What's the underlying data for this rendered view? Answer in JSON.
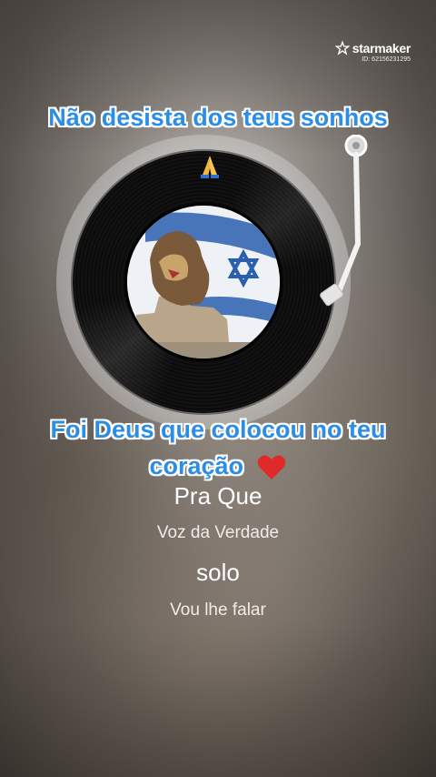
{
  "watermark": {
    "brand": "starmaker",
    "id": "ID: 62156231295"
  },
  "lyrics": {
    "line1": "Não desista dos teus sonhos",
    "line2a": "Foi Deus que colocou no teu",
    "line2b": "coração",
    "next": "Vou lhe falar"
  },
  "song": {
    "title": "Pra Que",
    "artist": "Voz da Verdade",
    "mode": "solo"
  },
  "icons": {
    "pray": "pray-emoji-icon",
    "heart": "red-heart-emoji-icon",
    "logo": "starmaker-star-icon"
  },
  "colors": {
    "lyric_text": "#2b8de6",
    "lyric_outline": "#ffffff",
    "heart": "#e02a2a"
  }
}
